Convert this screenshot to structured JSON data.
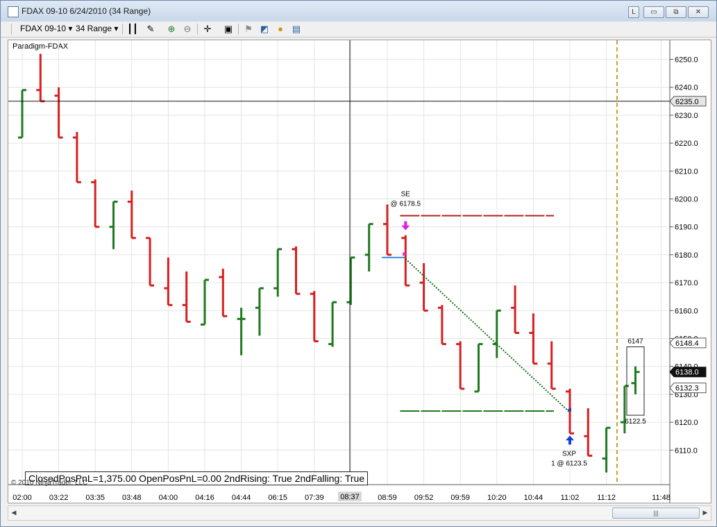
{
  "window": {
    "title": "FDAX 09-10  6/24/2010 (34 Range)",
    "controls": {
      "link": "L",
      "minimize": "▭",
      "restore": "⧉",
      "close": "✕"
    }
  },
  "toolbar": {
    "instrument": "FDAX 09-10",
    "interval": "34 Range",
    "icons": [
      "bar-style-icon",
      "draw-pen-icon",
      "zoom-in-icon",
      "zoom-out-icon",
      "crosshair-icon",
      "properties-icon",
      "strategy-icon",
      "indicator-icon",
      "money-icon",
      "data-box-icon"
    ]
  },
  "panel": {
    "label": "Paradigm-FDAX"
  },
  "status_text": "ClosedPosPnL=1,375.00 OpenPosPnL=0.00 2ndRising: True 2ndFalling: True",
  "copyright": "© 2010 NinjaTrader, LLC",
  "crosshair": {
    "price_label": "6235.0",
    "time_label": "08:37"
  },
  "price_markers": {
    "last": "6138.0",
    "upper": "6148.4",
    "lower": "6132.3"
  },
  "trades": {
    "entry_name": "SE",
    "entry_price_text": "@ 6178.5",
    "exit_name": "SXP",
    "exit_price_text": "1 @ 6123.5"
  },
  "range_box": {
    "high": "6147",
    "low": "6122.5"
  },
  "colors": {
    "up": "#1e7a1e",
    "down": "#d81e1e",
    "target": "#b02020",
    "stop": "#1e7a1e",
    "dash": "#c8a030",
    "entry_arrow": "#e020e0",
    "exit_arrow": "#1040e0"
  },
  "chart_data": {
    "type": "bar",
    "y_axis": {
      "min": 6100,
      "max": 6255,
      "ticks": [
        6110,
        6120,
        6130,
        6140,
        6150,
        6160,
        6170,
        6180,
        6190,
        6200,
        6210,
        6220,
        6230,
        6240,
        6250
      ],
      "tick_labels": [
        "6110.0",
        "6120.0",
        "6130.0",
        "6140.0",
        "6150.0",
        "6160.0",
        "6170.0",
        "6180.0",
        "6190.0",
        "6200.0",
        "6210.0",
        "6220.0",
        "6230.0",
        "6240.0",
        "6250.0"
      ]
    },
    "x_axis": {
      "tick_labels": [
        "02:00",
        "03:22",
        "03:35",
        "03:48",
        "04:00",
        "04:16",
        "04:44",
        "06:15",
        "07:39",
        "08:37",
        "08:59",
        "09:52",
        "09:59",
        "10:20",
        "10:44",
        "11:02",
        "11:12",
        "11:48"
      ],
      "tick_bars": [
        0,
        2,
        4,
        6,
        8,
        10,
        12,
        14,
        16,
        18,
        20,
        22,
        24,
        26,
        28,
        30,
        32,
        35
      ]
    },
    "bars": [
      {
        "o": 6222,
        "h": 6239,
        "l": 6222,
        "c": 6239
      },
      {
        "o": 6239,
        "h": 6252,
        "l": 6235,
        "c": 6235
      },
      {
        "o": 6237,
        "h": 6240,
        "l": 6222,
        "c": 6222
      },
      {
        "o": 6222,
        "h": 6224,
        "l": 6206,
        "c": 6206
      },
      {
        "o": 6206,
        "h": 6207,
        "l": 6190,
        "c": 6190
      },
      {
        "o": 6190,
        "h": 6199,
        "l": 6182,
        "c": 6199
      },
      {
        "o": 6199,
        "h": 6203,
        "l": 6186,
        "c": 6186
      },
      {
        "o": 6186,
        "h": 6186,
        "l": 6169,
        "c": 6169
      },
      {
        "o": 6168,
        "h": 6179,
        "l": 6162,
        "c": 6162
      },
      {
        "o": 6162,
        "h": 6174,
        "l": 6156,
        "c": 6156
      },
      {
        "o": 6155,
        "h": 6171,
        "l": 6155,
        "c": 6171
      },
      {
        "o": 6172,
        "h": 6175,
        "l": 6158,
        "c": 6158
      },
      {
        "o": 6157,
        "h": 6161,
        "l": 6144,
        "c": 6157
      },
      {
        "o": 6161,
        "h": 6168,
        "l": 6151,
        "c": 6168
      },
      {
        "o": 6168,
        "h": 6182,
        "l": 6165,
        "c": 6182
      },
      {
        "o": 6182,
        "h": 6183,
        "l": 6166,
        "c": 6166
      },
      {
        "o": 6166,
        "h": 6167,
        "l": 6149,
        "c": 6149
      },
      {
        "o": 6148,
        "h": 6163,
        "l": 6147,
        "c": 6163
      },
      {
        "o": 6163,
        "h": 6179,
        "l": 6162,
        "c": 6179
      },
      {
        "o": 6180,
        "h": 6191,
        "l": 6174,
        "c": 6191
      },
      {
        "o": 6191,
        "h": 6198,
        "l": 6180,
        "c": 6180
      },
      {
        "o": 6186,
        "h": 6187,
        "l": 6169,
        "c": 6169
      },
      {
        "o": 6170,
        "h": 6177,
        "l": 6160,
        "c": 6160
      },
      {
        "o": 6161,
        "h": 6162,
        "l": 6148,
        "c": 6148
      },
      {
        "o": 6148,
        "h": 6149,
        "l": 6132,
        "c": 6132
      },
      {
        "o": 6131,
        "h": 6148,
        "l": 6131,
        "c": 6148
      },
      {
        "o": 6148,
        "h": 6160,
        "l": 6143,
        "c": 6160
      },
      {
        "o": 6161,
        "h": 6169,
        "l": 6152,
        "c": 6152
      },
      {
        "o": 6152,
        "h": 6159,
        "l": 6141,
        "c": 6141
      },
      {
        "o": 6141,
        "h": 6149,
        "l": 6132,
        "c": 6132
      },
      {
        "o": 6131,
        "h": 6132,
        "l": 6116,
        "c": 6116
      },
      {
        "o": 6115,
        "h": 6125,
        "l": 6108,
        "c": 6108
      },
      {
        "o": 6107,
        "h": 6118,
        "l": 6102,
        "c": 6118
      },
      {
        "o": 6120,
        "h": 6133,
        "l": 6116,
        "c": 6133
      }
    ],
    "pending_bar": {
      "o": 6134,
      "h": 6140,
      "l": 6130,
      "c": 6138
    },
    "target_line": 6194,
    "stop_line": 6124,
    "entry_line": 6179,
    "trade_line": {
      "from_bar": 21,
      "from_price": 6178.5,
      "to_bar": 30,
      "to_price": 6123.5
    }
  }
}
